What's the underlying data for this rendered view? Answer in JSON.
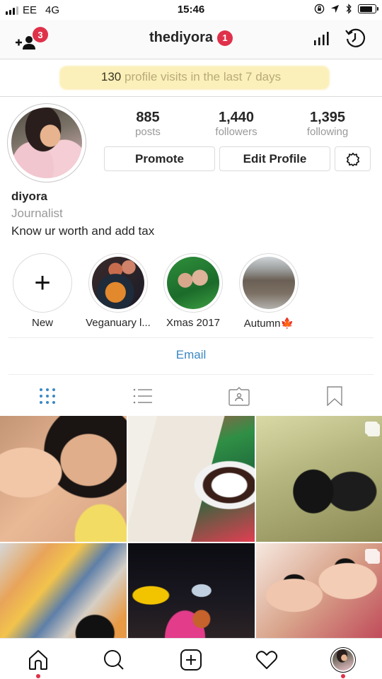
{
  "status_bar": {
    "carrier": "EE",
    "network": "4G",
    "time": "15:46",
    "battery_level": 0.85,
    "icons": [
      "signal-icon",
      "orientation-lock-icon",
      "location-icon",
      "bluetooth-icon",
      "battery-icon"
    ]
  },
  "header": {
    "username": "thediyora",
    "account_badge": "1",
    "discover_people_badge": "3",
    "icons": [
      "add-person-icon",
      "insights-icon",
      "archive-icon"
    ]
  },
  "visits_banner": {
    "count": "130",
    "text": "profile visits in the last 7 days"
  },
  "profile": {
    "stats": [
      {
        "value": "885",
        "label": "posts"
      },
      {
        "value": "1,440",
        "label": "followers"
      },
      {
        "value": "1,395",
        "label": "following"
      }
    ],
    "buttons": {
      "promote": "Promote",
      "edit_profile": "Edit Profile"
    },
    "name": "diyora",
    "category": "Journalist",
    "bio": "Know ur worth and add tax",
    "contact": "Email"
  },
  "highlights": [
    {
      "label": "New"
    },
    {
      "label": "Veganuary l..."
    },
    {
      "label": "Xmas 2017"
    },
    {
      "label": "Autumn",
      "emoji": "🍁"
    }
  ],
  "tabs": [
    {
      "name": "grid",
      "active": true
    },
    {
      "name": "list",
      "active": false
    },
    {
      "name": "tagged",
      "active": false
    },
    {
      "name": "saved",
      "active": false
    }
  ],
  "posts": [
    {
      "subject": "two friends selfie",
      "multiple": false
    },
    {
      "subject": "book and tea on magazine",
      "multiple": false
    },
    {
      "subject": "friends posing at flower wall",
      "multiple": true
    },
    {
      "subject": "abstract painted artwork",
      "multiple": false
    },
    {
      "subject": "woman at night station",
      "multiple": false
    },
    {
      "subject": "friends in sunglasses selfie",
      "multiple": true
    }
  ],
  "bottom_nav": {
    "items": [
      "home",
      "search",
      "add",
      "activity",
      "profile"
    ],
    "active": "profile"
  },
  "colors": {
    "badge": "#e0314a",
    "link": "#3b88c3",
    "active_tab": "#3b88c3",
    "highlight": "#fbeeb3"
  }
}
